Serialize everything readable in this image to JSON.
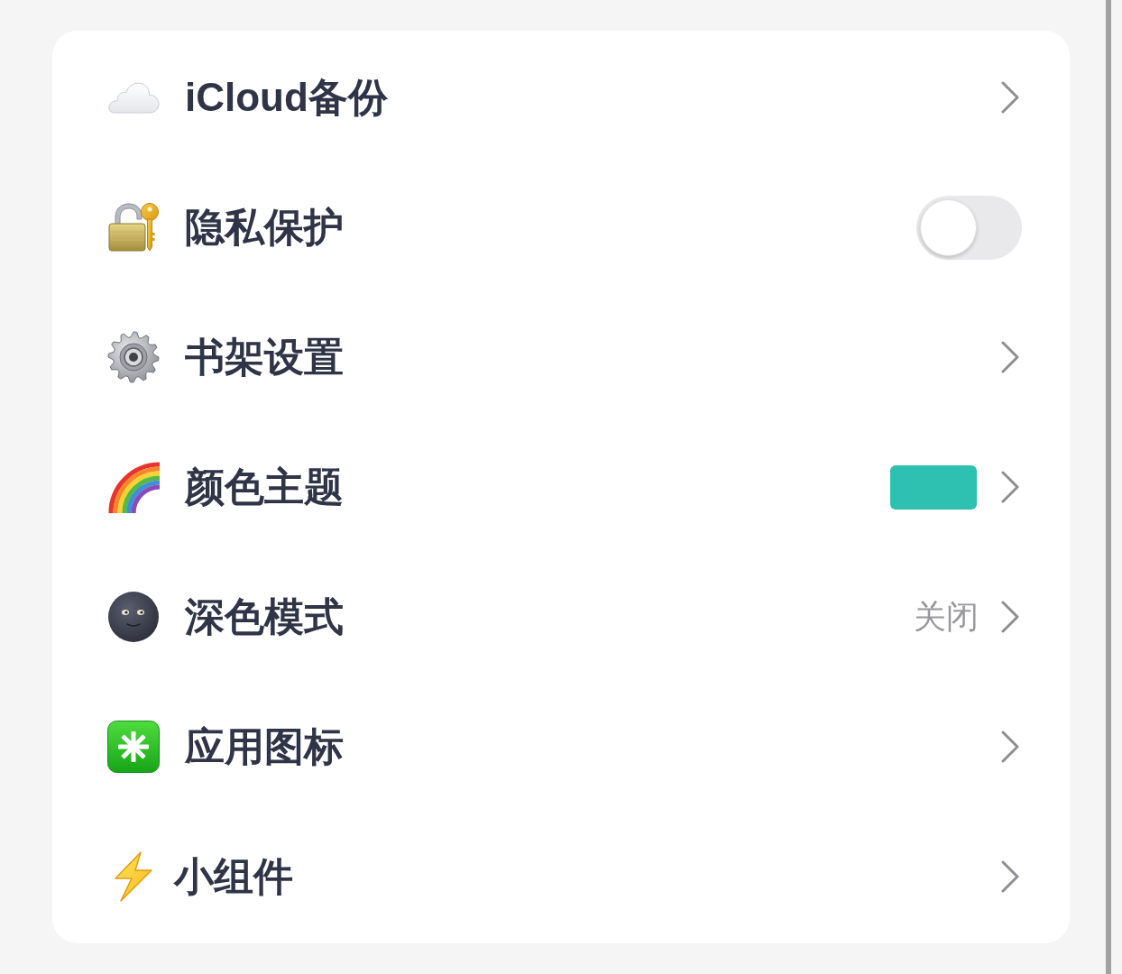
{
  "items": [
    {
      "kind": "link",
      "label": "iCloud备份"
    },
    {
      "kind": "toggle",
      "label": "隐私保护",
      "on": false
    },
    {
      "kind": "link",
      "label": "书架设置"
    },
    {
      "kind": "color",
      "label": "颜色主题",
      "color": "#2ec0b0"
    },
    {
      "kind": "value",
      "label": "深色模式",
      "value": "关闭"
    },
    {
      "kind": "link",
      "label": "应用图标"
    },
    {
      "kind": "link",
      "label": "小组件"
    }
  ]
}
